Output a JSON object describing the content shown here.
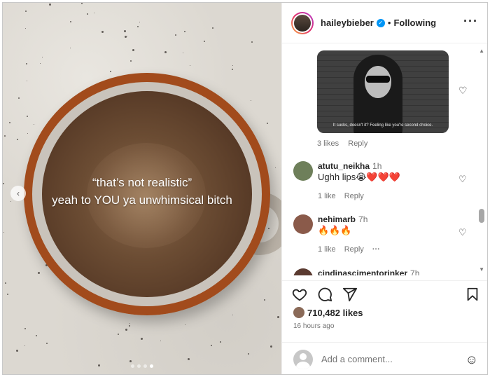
{
  "media": {
    "overlay_line1": "“that’s not realistic”",
    "overlay_line2": "yeah to YOU ya unwhimsical bitch",
    "prev_arrow": "‹",
    "page_dots": 4,
    "active_dot": 4
  },
  "header": {
    "username": "haileybieber",
    "separator": "•",
    "follow_state": "Following",
    "more": "···",
    "verified_icon": "verified-badge-icon"
  },
  "gif_comment": {
    "caption": "It sucks, doesn't it? Feeling like you're second choice.",
    "likes": "3 likes",
    "reply": "Reply"
  },
  "comments": [
    {
      "username": "atutu_neikha",
      "time": "1h",
      "text": "Ughh lips😭❤️❤️❤️",
      "likes": "1 like",
      "reply": "Reply",
      "avatar_color": "#6e7f5a"
    },
    {
      "username": "nehimarb",
      "time": "7h",
      "text": "🔥🔥🔥",
      "likes": "1 like",
      "reply": "Reply",
      "more": "···",
      "avatar_color": "#8a5a4a"
    },
    {
      "username": "cindinascimentorinker",
      "time": "7h",
      "text": "",
      "avatar_color": "#5a3a30"
    }
  ],
  "footer": {
    "likes_count": "710,482 likes",
    "time_ago": "16 hours ago",
    "comment_placeholder": "Add a comment...",
    "emoji_icon": "☺"
  },
  "colors": {
    "accent": "#0095f6",
    "text": "#262626",
    "muted": "#737373"
  }
}
